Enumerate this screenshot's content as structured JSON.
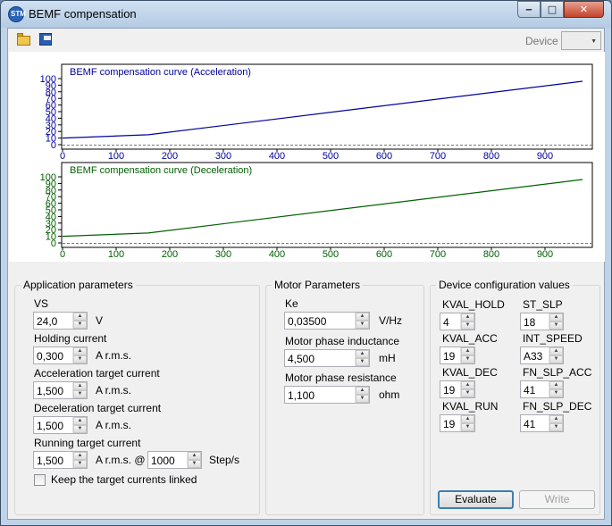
{
  "window": {
    "title": "BEMF compensation",
    "minimize_glyph": "‒",
    "maximize_glyph": "□",
    "close_glyph": "✕"
  },
  "toolbar": {
    "icons": [
      "open-folder-icon",
      "save-icon"
    ],
    "device_label": "Device",
    "device_value": "",
    "dropdown_glyph": "▼"
  },
  "chart_data": [
    {
      "type": "line",
      "title": "BEMF compensation curve (Acceleration)",
      "color": "#0000a0",
      "xlim": [
        0,
        980
      ],
      "ylim": [
        0,
        100
      ],
      "x_ticks": [
        0,
        100,
        200,
        300,
        400,
        500,
        600,
        700,
        800,
        900
      ],
      "y_ticks": [
        0,
        10,
        20,
        30,
        40,
        50,
        60,
        70,
        80,
        90,
        100
      ],
      "points": [
        [
          0,
          10
        ],
        [
          160,
          15
        ],
        [
          970,
          96
        ]
      ]
    },
    {
      "type": "line",
      "title": "BEMF compensation curve (Deceleration)",
      "color": "#006000",
      "xlim": [
        0,
        980
      ],
      "ylim": [
        0,
        100
      ],
      "x_ticks": [
        0,
        100,
        200,
        300,
        400,
        500,
        600,
        700,
        800,
        900
      ],
      "y_ticks": [
        0,
        10,
        20,
        30,
        40,
        50,
        60,
        70,
        80,
        90,
        100
      ],
      "points": [
        [
          0,
          10
        ],
        [
          160,
          15
        ],
        [
          970,
          96
        ]
      ]
    }
  ],
  "app_params": {
    "title": "Application parameters",
    "vs_label": "VS",
    "vs_value": "24,0",
    "vs_unit": "V",
    "holding_label": "Holding current",
    "holding_value": "0,300",
    "holding_unit": "A r.m.s.",
    "acc_label": "Acceleration target current",
    "acc_value": "1,500",
    "acc_unit": "A r.m.s.",
    "dec_label": "Deceleration target current",
    "dec_value": "1,500",
    "dec_unit": "A r.m.s.",
    "run_label": "Running target current",
    "run_value": "1,500",
    "run_unit": "A r.m.s. @",
    "speed_value": "1000",
    "speed_unit": "Step/s",
    "link_label": "Keep the target currents linked",
    "link_checked": false
  },
  "motor_params": {
    "title": "Motor Parameters",
    "ke_label": "Ke",
    "ke_value": "0,03500",
    "ke_unit": "V/Hz",
    "ind_label": "Motor phase inductance",
    "ind_value": "4,500",
    "ind_unit": "mH",
    "res_label": "Motor phase resistance",
    "res_value": "1,100",
    "res_unit": "ohm"
  },
  "device_config": {
    "title": "Device configuration values",
    "kval_hold_label": "KVAL_HOLD",
    "kval_hold_value": "4",
    "kval_acc_label": "KVAL_ACC",
    "kval_acc_value": "19",
    "kval_dec_label": "KVAL_DEC",
    "kval_dec_value": "19",
    "kval_run_label": "KVAL_RUN",
    "kval_run_value": "19",
    "st_slp_label": "ST_SLP",
    "st_slp_value": "18",
    "int_speed_label": "INT_SPEED",
    "int_speed_value": "A33",
    "fn_slp_acc_label": "FN_SLP_ACC",
    "fn_slp_acc_value": "41",
    "fn_slp_dec_label": "FN_SLP_DEC",
    "fn_slp_dec_value": "41"
  },
  "buttons": {
    "evaluate": "Evaluate",
    "write": "Write"
  },
  "spin": {
    "up": "▲",
    "down": "▼"
  }
}
